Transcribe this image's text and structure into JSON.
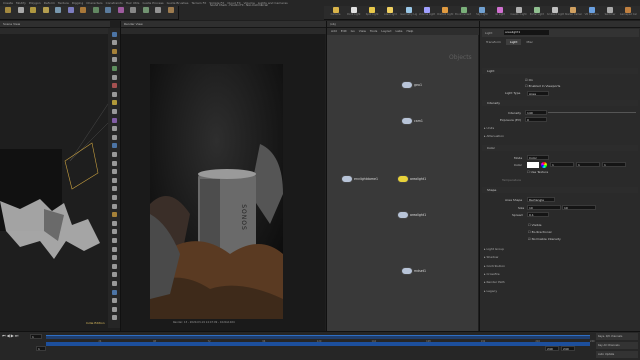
{
  "window": {
    "title": "Sound Check - Houdini FX - Non-Commercial"
  },
  "shelf_tabs": [
    "Create",
    "Modify",
    "Polygon",
    "Deform",
    "Texture",
    "Rigging",
    "Characters",
    "Constraints",
    "Hair Utils",
    "Guide Process",
    "Guide Brushes",
    "Terrain FX",
    "Simple FX",
    "Cloud FX",
    "Volume",
    "Lights and Cameras",
    "Collisions",
    "Particles",
    "Grains",
    "Vellum",
    "Rigid Bodies",
    "Particle Fluids",
    "Viscous Fluids",
    "Oceans",
    "Pyro FX",
    "FEM",
    "Wires",
    "Crowds",
    "Drive Simulation"
  ],
  "shelf_tools": [
    "Camera",
    "Point Light",
    "Spot Light",
    "Area Light",
    "Geometry Light",
    "Volume Light",
    "Distant Light",
    "Environment Light",
    "Sky Light",
    "GI Light",
    "Caustic Light",
    "Portal Light",
    "Ambient Light",
    "Stereo Camera",
    "VR Camera",
    "Switcher",
    "Gamepad Camera"
  ],
  "viewport_left": {
    "tab": "Scene View",
    "label": "Indie Edition"
  },
  "render_view": {
    "tab": "Render View",
    "footer": "Render: 13 - 2020-03-19 14:47:09 - 1024x1024",
    "product_text": "SONOS"
  },
  "network": {
    "tab": "/obj",
    "menu": [
      "Add",
      "Edit",
      "Go",
      "View",
      "Tools",
      "Layout",
      "Labs",
      "Help"
    ],
    "context_label": "Objects",
    "nodes": [
      {
        "name": "geo1",
        "selected": false
      },
      {
        "name": "cam1",
        "selected": false
      },
      {
        "name": "envlightdome1",
        "selected": false
      },
      {
        "name": "arealight1",
        "selected": true
      },
      {
        "name": "arealight1",
        "selected": false
      },
      {
        "name": "cam1",
        "selected": false
      },
      {
        "name": "mdset1",
        "selected": false
      }
    ]
  },
  "params": {
    "type_label": "Light",
    "node_name": "arealight1",
    "tabs": [
      "Transform",
      "Light",
      "Misc"
    ],
    "active_tab": "Light",
    "sections": [
      "Light",
      "Intensity",
      "Color",
      "Shape"
    ],
    "on_label": "On",
    "viewport_label": "Enabled In Viewports",
    "light_type_label": "Light Type",
    "light_type_value": "Area",
    "intensity_label": "Intensity",
    "intensity_value": "140",
    "exposure_label": "Exposure (EV)",
    "exposure_value": "0",
    "units_label": "Units",
    "attenuation_label": "Attenuation",
    "mode_label": "Mode",
    "mode_value": "Color",
    "color_label": "Color",
    "color_value": "1",
    "color_g": "1",
    "color_b": "1",
    "use_texture_label": "Use Texture",
    "temperature_label": "Temperature",
    "area_shape_label": "Area Shape",
    "area_shape_value": "Rectangle",
    "size_label": "Size",
    "size_x": "10",
    "size_y": "10",
    "spread_label": "Spread",
    "spread_value": "0.1",
    "visible_label": "Visible",
    "bidirectional_label": "Bi-directional",
    "normalize_label": "Normalize Intensity",
    "folds": [
      "Light Group",
      "Shadow",
      "Contribution",
      "Crossfire",
      "Render Path",
      "Legacy"
    ]
  },
  "timeline": {
    "frame": "1",
    "start": "1",
    "end": "240",
    "range_end": "240",
    "ticks": [
      "24",
      "48",
      "72",
      "96",
      "120",
      "144",
      "168",
      "192",
      "216",
      "240"
    ],
    "right_buttons": [
      "Keys, 0/0 channels",
      "Key All Channels",
      "Auto Update"
    ]
  },
  "colors": {
    "accent": "#4a90d9",
    "timeline_bar": "#2e6ec4",
    "selected_node": "#e8d23a"
  }
}
